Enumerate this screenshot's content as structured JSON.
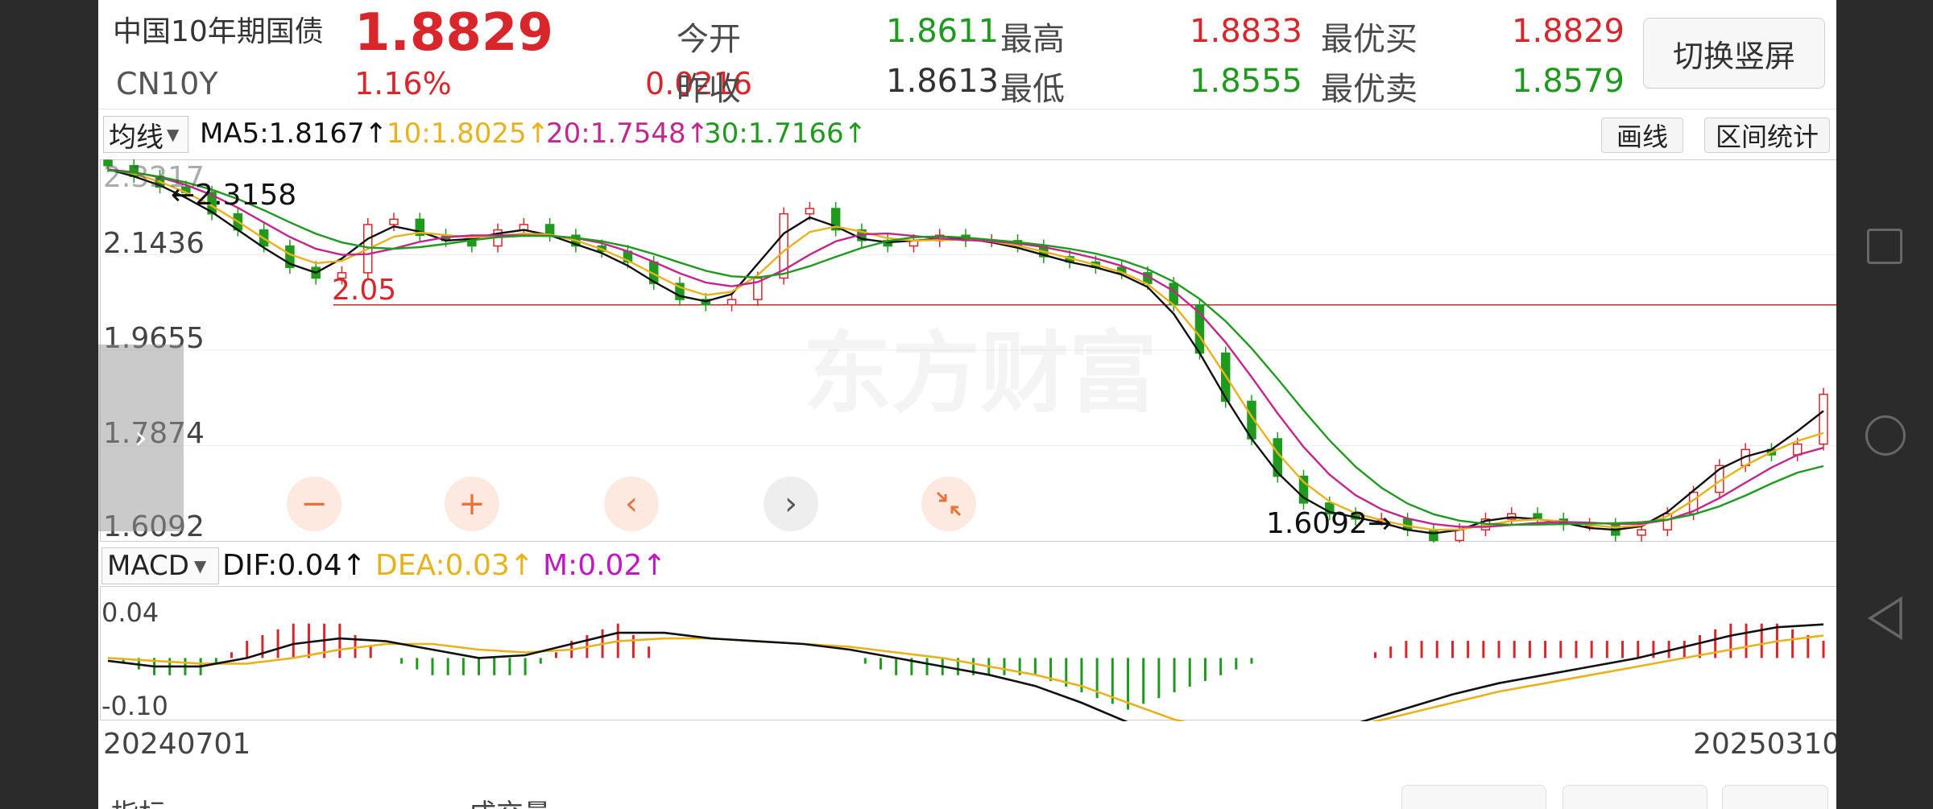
{
  "header": {
    "name": "中国10年期国债",
    "code": "CN10Y",
    "price": "1.8829",
    "change_pct": "1.16%",
    "change": "0.0216",
    "open_label": "今开",
    "open": "1.8611",
    "prev_close_label": "昨收",
    "prev_close": "1.8613",
    "high_label": "最高",
    "high": "1.8833",
    "low_label": "最低",
    "low": "1.8555",
    "best_bid_label": "最优买",
    "best_bid": "1.8829",
    "best_ask_label": "最优卖",
    "best_ask": "1.8579",
    "switch_button": "切换竖屏"
  },
  "toolbar": {
    "indicator_select": "均线",
    "ma5": "MA5:1.8167↑",
    "ma10": "10:1.8025↑",
    "ma20": "20:1.7548↑",
    "ma30": "30:1.7166↑",
    "draw_button": "画线",
    "range_button": "区间统计"
  },
  "main_chart": {
    "y_ticks": [
      "2.1436",
      "1.9655",
      "1.7874",
      "1.6092"
    ],
    "top_partial_label": "2.3217",
    "max_annotation": "←2.3158",
    "line_label": "2.05",
    "min_annotation": "1.6092→",
    "watermark": "东方财富"
  },
  "macd": {
    "select": "MACD",
    "dif": "DIF:0.04↑",
    "dea": "DEA:0.03↑",
    "m": "M:0.02↑",
    "y_top": "0.04",
    "y_bottom": "-0.10"
  },
  "x_axis": {
    "start": "20240701",
    "end": "20250310"
  },
  "chart_data": [
    {
      "type": "candlestick",
      "title": "",
      "ylim": [
        1.6092,
        2.3217
      ],
      "x_range": [
        "20240701",
        "20250310"
      ],
      "reference_line": 2.05,
      "annotations": {
        "max": 2.3158,
        "min": 1.6092
      },
      "series": [
        {
          "name": "MA5",
          "last": 1.8167
        },
        {
          "name": "MA10",
          "last": 1.8025
        },
        {
          "name": "MA20",
          "last": 1.7548
        },
        {
          "name": "MA30",
          "last": 1.7166
        }
      ],
      "close_approx": [
        2.31,
        2.29,
        2.27,
        2.26,
        2.22,
        2.19,
        2.16,
        2.12,
        2.1,
        2.11,
        2.2,
        2.21,
        2.18,
        2.17,
        2.16,
        2.19,
        2.2,
        2.18,
        2.16,
        2.15,
        2.13,
        2.09,
        2.06,
        2.05,
        2.06,
        2.1,
        2.22,
        2.23,
        2.19,
        2.17,
        2.16,
        2.17,
        2.18,
        2.17,
        2.17,
        2.16,
        2.14,
        2.13,
        2.12,
        2.11,
        2.09,
        2.05,
        1.96,
        1.87,
        1.8,
        1.73,
        1.68,
        1.66,
        1.65,
        1.65,
        1.63,
        1.61,
        1.63,
        1.65,
        1.66,
        1.65,
        1.64,
        1.64,
        1.62,
        1.63,
        1.66,
        1.7,
        1.75,
        1.78,
        1.77,
        1.79,
        1.8829
      ]
    },
    {
      "type": "line",
      "title": "MACD",
      "ylim": [
        -0.1,
        0.04
      ],
      "series": [
        {
          "name": "DIF",
          "last": 0.04
        },
        {
          "name": "DEA",
          "last": 0.03
        },
        {
          "name": "M",
          "last": 0.02
        }
      ],
      "dif_approx": [
        0.0,
        -0.01,
        -0.02,
        0.0,
        0.02,
        0.03,
        0.02,
        0.01,
        0.0,
        -0.01,
        0.02,
        0.04,
        0.03,
        0.02,
        0.02,
        0.02,
        0.01,
        0.0,
        -0.01,
        -0.02,
        -0.03,
        -0.05,
        -0.08,
        -0.1,
        -0.1,
        -0.09,
        -0.09,
        -0.08,
        -0.06,
        -0.04,
        -0.03,
        -0.02,
        -0.01,
        0.0,
        0.01,
        0.03,
        0.04,
        0.04
      ],
      "dea_approx": [
        0.0,
        0.0,
        -0.01,
        -0.01,
        0.0,
        0.01,
        0.02,
        0.02,
        0.01,
        0.0,
        0.01,
        0.02,
        0.03,
        0.02,
        0.02,
        0.02,
        0.01,
        0.01,
        0.0,
        -0.01,
        -0.02,
        -0.03,
        -0.05,
        -0.08,
        -0.09,
        -0.09,
        -0.09,
        -0.08,
        -0.07,
        -0.05,
        -0.04,
        -0.03,
        -0.02,
        -0.01,
        0.0,
        0.01,
        0.02,
        0.03
      ]
    }
  ],
  "colors": {
    "up": "#d9262b",
    "down": "#1f9a1f",
    "ma5": "#111111",
    "ma10": "#e8b21c",
    "ma20": "#c2278d",
    "ma30": "#1f9a1f",
    "accent_orange": "#e8733a"
  },
  "bottom_row": {
    "item1": "指标",
    "item2": "成交量"
  }
}
